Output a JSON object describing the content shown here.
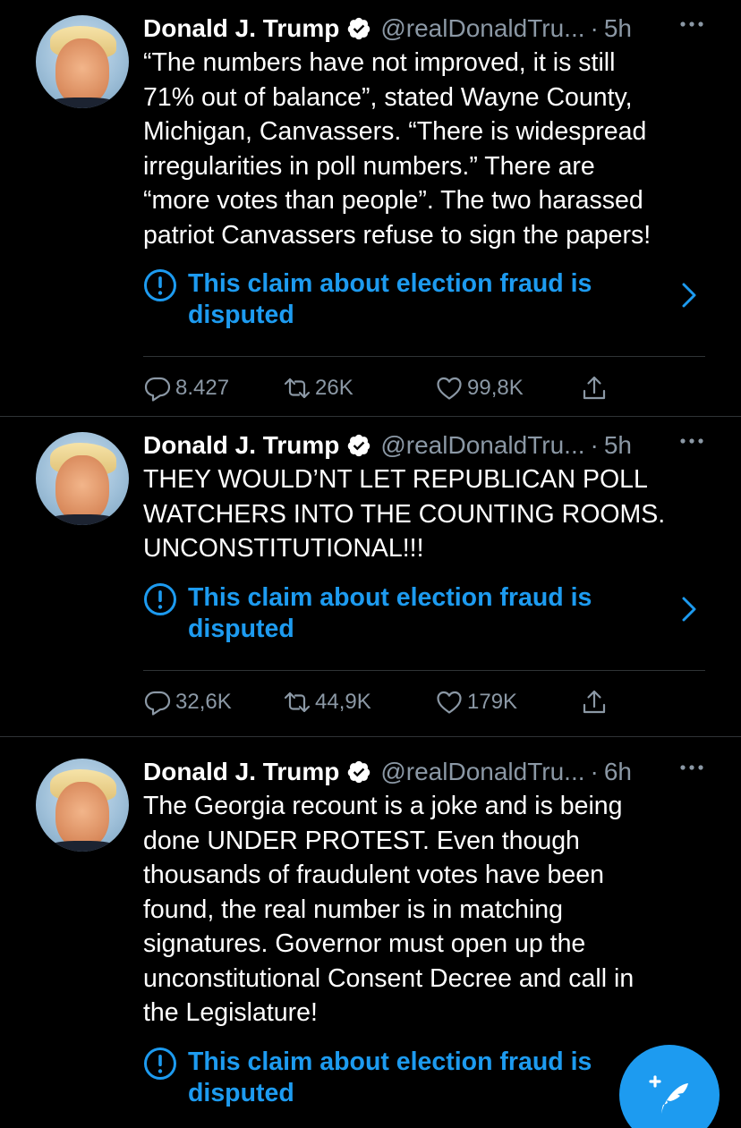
{
  "colors": {
    "background": "#000000",
    "accent_blue": "#1d9bf0",
    "secondary_text": "#8b98a5",
    "divider": "#2f3336"
  },
  "tweets": [
    {
      "name": "Donald J. Trump",
      "handle": "@realDonaldTru...",
      "separator": "·",
      "time": "5h",
      "text": "“The numbers have not improved, it is still\n71% out of balance”, stated Wayne County,\nMichigan,  Canvassers. “There is widespread\nirregularities in poll numbers.” There are\n“more votes than people”. The two harassed\npatriot Canvassers refuse to sign the papers!",
      "notice": "This claim about election fraud\nis disputed",
      "replies": "8.427",
      "retweets": "26K",
      "likes": "99,8K"
    },
    {
      "name": "Donald J. Trump",
      "handle": "@realDonaldTru...",
      "separator": "·",
      "time": "5h",
      "text": "THEY WOULD’NT LET REPUBLICAN POLL\nWATCHERS INTO THE COUNTING ROOMS.\nUNCONSTITUTIONAL!!!",
      "notice": "This claim about election fraud\nis disputed",
      "replies": "32,6K",
      "retweets": "44,9K",
      "likes": "179K"
    },
    {
      "name": "Donald J. Trump",
      "handle": "@realDonaldTru...",
      "separator": "·",
      "time": "6h",
      "text": "The Georgia recount is a joke and is being\ndone UNDER PROTEST. Even though\nthousands of fraudulent votes have been\nfound, the real number is in matching\nsignatures. Governor must open up the\nunconstitutional Consent Decree and call in\nthe Legislature!",
      "notice": "This claim about election fraud\nis disputed"
    }
  ],
  "icons": {
    "verified": "verified-badge-icon",
    "more": "more-options-icon",
    "notice": "exclamation-circle-icon",
    "chevron": "chevron-right-icon",
    "reply": "reply-icon",
    "retweet": "retweet-icon",
    "like": "heart-icon",
    "share": "share-icon",
    "compose": "compose-tweet-icon"
  }
}
